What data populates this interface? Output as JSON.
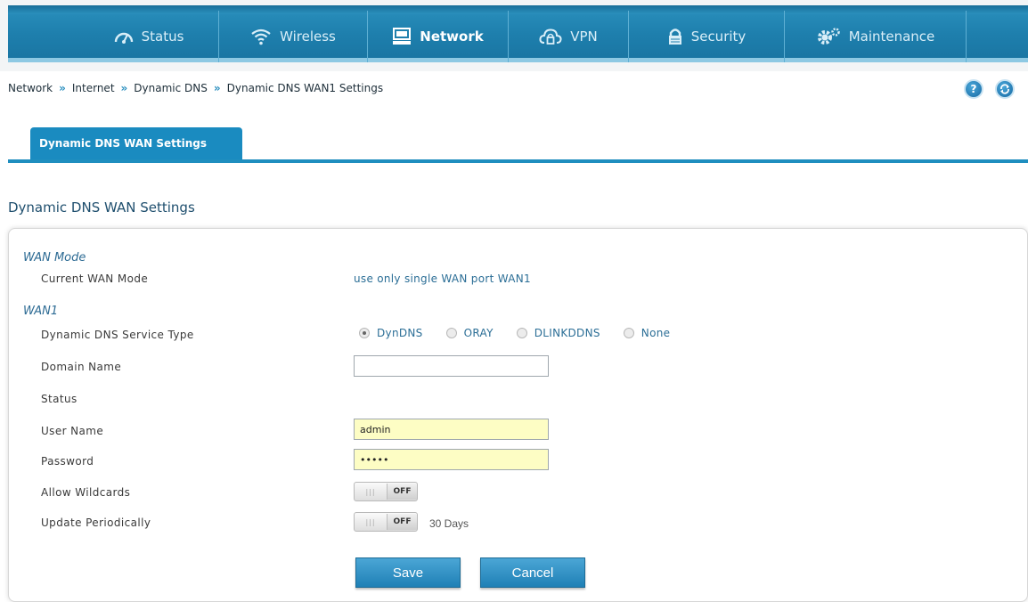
{
  "nav": {
    "items": [
      {
        "label": "Status",
        "icon": "speedometer-icon"
      },
      {
        "label": "Wireless",
        "icon": "wifi-icon"
      },
      {
        "label": "Network",
        "icon": "monitor-icon",
        "active": true
      },
      {
        "label": "VPN",
        "icon": "cloud-lock-icon"
      },
      {
        "label": "Security",
        "icon": "padlock-icon"
      },
      {
        "label": "Maintenance",
        "icon": "gears-icon"
      }
    ]
  },
  "breadcrumb": [
    "Network",
    "Internet",
    "Dynamic DNS",
    "Dynamic DNS WAN1 Settings"
  ],
  "breadcrumb_sep": "»",
  "help_icon": "?",
  "tab": {
    "label": "Dynamic DNS WAN Settings"
  },
  "section": {
    "title": "Dynamic DNS WAN Settings"
  },
  "wan_mode": {
    "group_label": "WAN Mode",
    "current_label": "Current WAN Mode",
    "current_value": "use only single WAN port WAN1"
  },
  "wan1": {
    "group_label": "WAN1",
    "service_type_label": "Dynamic DNS Service Type",
    "service_options": [
      "DynDNS",
      "ORAY",
      "DLINKDDNS",
      "None"
    ],
    "service_selected": "DynDNS",
    "domain_name_label": "Domain Name",
    "domain_name_value": "",
    "status_label": "Status",
    "user_name_label": "User Name",
    "user_name_value": "admin",
    "password_label": "Password",
    "password_value": "•••••",
    "allow_wildcards_label": "Allow Wildcards",
    "allow_wildcards_state": "OFF",
    "update_periodically_label": "Update Periodically",
    "update_periodically_state": "OFF",
    "update_periodically_suffix": "30 Days"
  },
  "buttons": {
    "save": "Save",
    "cancel": "Cancel"
  },
  "colors": {
    "nav_blue": "#1e7fad",
    "tab_blue": "#1a8bc0",
    "text_blue": "#2b6e96",
    "input_yellow": "#fdfdc4"
  }
}
